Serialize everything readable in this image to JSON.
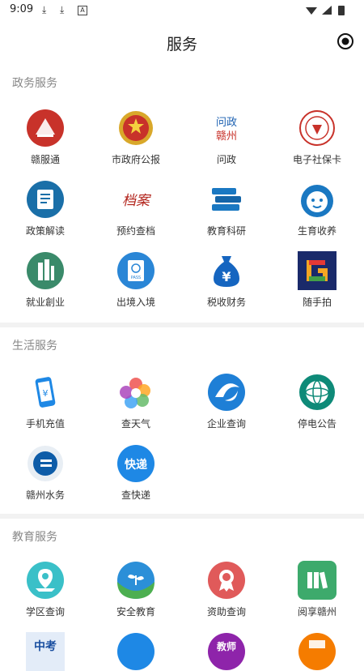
{
  "status": {
    "time": "9:09"
  },
  "header": {
    "title": "服务"
  },
  "gov": {
    "title": "政务服务",
    "items": [
      "赣服通",
      "市政府公报",
      "问政",
      "电子社保卡",
      "政策解读",
      "预约查档",
      "教育科研",
      "生育收养",
      "就业創业",
      "出境入境",
      "税收财务",
      "随手拍"
    ]
  },
  "life": {
    "title": "生活服务",
    "items": [
      "手机充值",
      "查天气",
      "企业查询",
      "停电公告",
      "赣州水务",
      "查快递"
    ]
  },
  "edu": {
    "title": "教育服务",
    "items": [
      "学区查询",
      "安全教育",
      "资助查询",
      "阅享赣州"
    ]
  },
  "icon_text": {
    "wenzheng": "问政",
    "ganzhou": "赣州",
    "dangan": "档案",
    "kuaidi": "快递",
    "zhongkao": "中考",
    "jiaoshi": "教师",
    "pass": "PASS"
  },
  "colors": {
    "accent_red": "#c8322a",
    "blue": "#1a78c2",
    "green": "#3a9a6a"
  }
}
